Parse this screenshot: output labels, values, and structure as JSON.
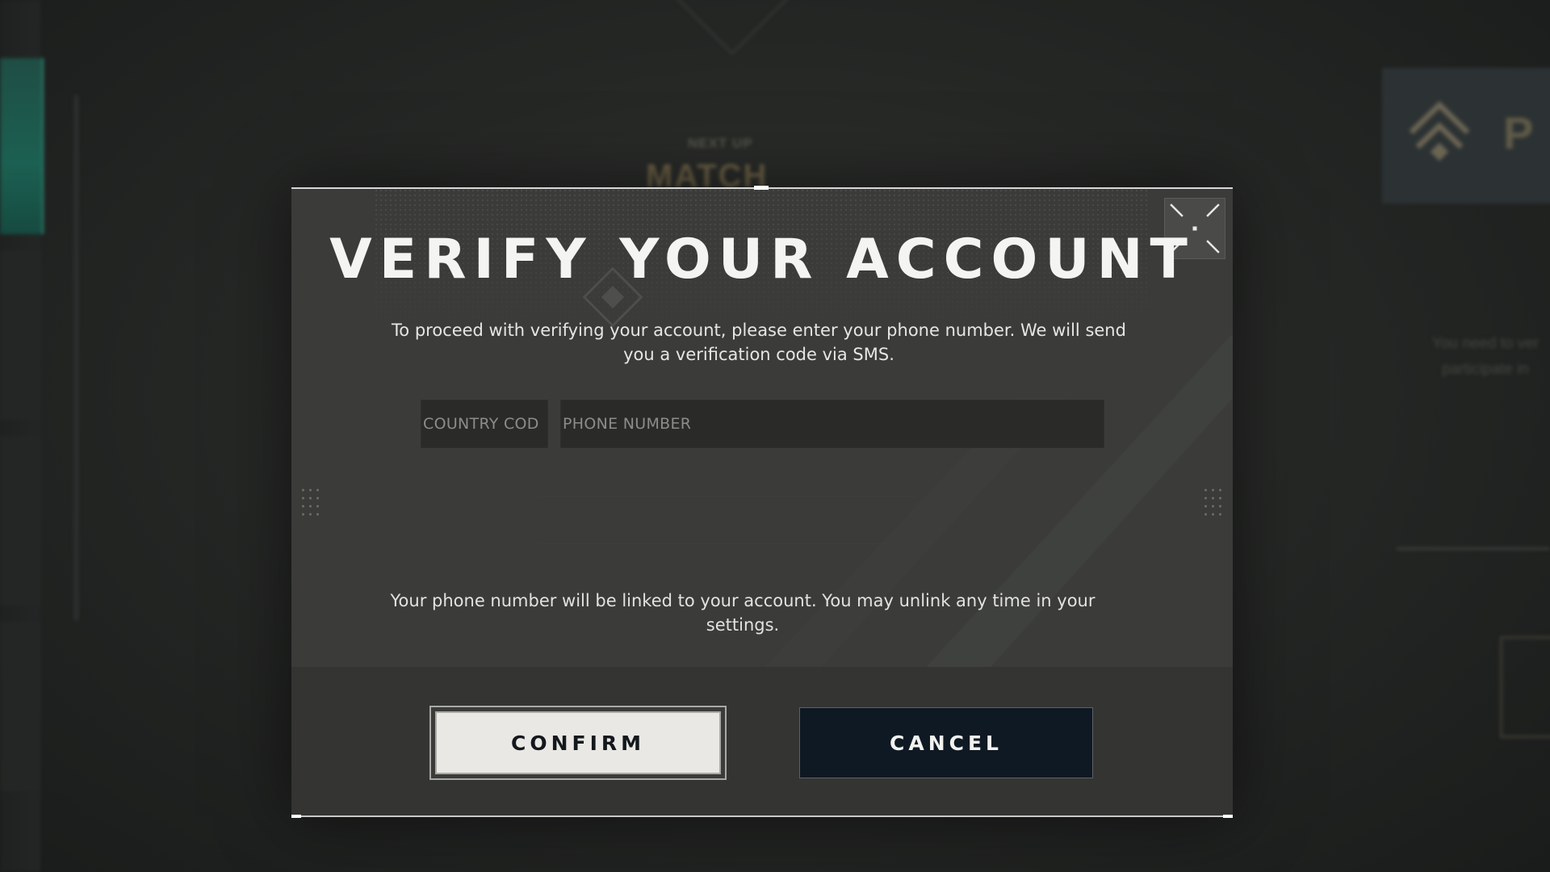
{
  "background": {
    "next_up_label": "NEXT UP",
    "match_label": "MATCH",
    "right_panel_initial": "P",
    "right_panel_text": "You need to ver participate in"
  },
  "dialog": {
    "title": "VERIFY YOUR ACCOUNT",
    "description": "To proceed with verifying your account, please enter your phone number. We will send you a verification code via SMS.",
    "country_code_placeholder": "COUNTRY COD",
    "phone_number_placeholder": "PHONE NUMBER",
    "country_code_value": "",
    "phone_number_value": "",
    "note": "Your phone number will be linked to your account. You may unlink any time in your settings.",
    "confirm_label": "CONFIRM",
    "cancel_label": "CANCEL",
    "collapse_icon": "collapse-arrows-icon"
  },
  "colors": {
    "modal_bg": "#3b3c3a",
    "confirm_bg": "#e9e8e4",
    "cancel_bg": "#0f1923",
    "title_text": "#f4f4f2"
  }
}
